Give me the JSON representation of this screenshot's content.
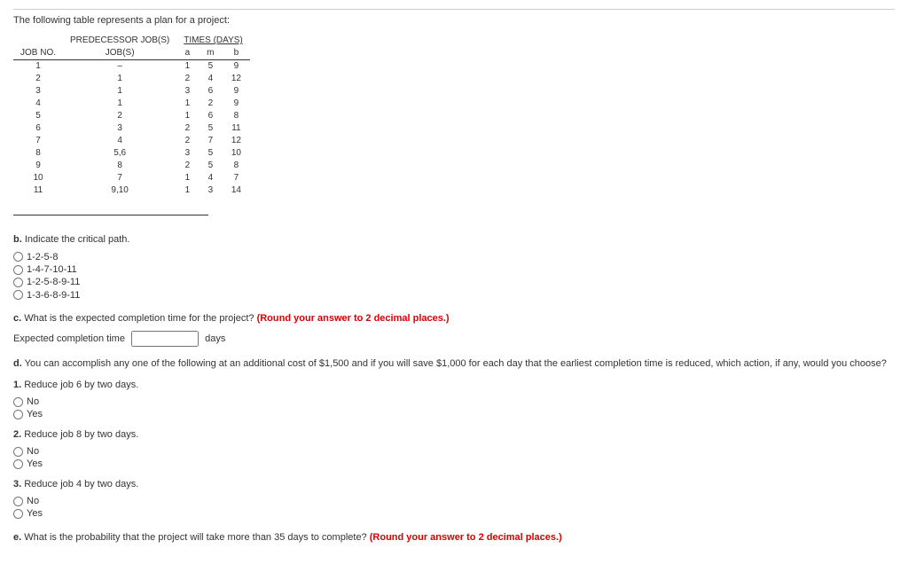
{
  "intro": "The following table represents a plan for a project:",
  "table": {
    "header": {
      "jobno": "JOB NO.",
      "pred": "PREDECESSOR JOB(S)",
      "times": "TIMES (DAYS)",
      "a": "a",
      "m": "m",
      "b": "b"
    },
    "rows": [
      {
        "job": "1",
        "pred": "–",
        "a": "1",
        "m": "5",
        "b": "9"
      },
      {
        "job": "2",
        "pred": "1",
        "a": "2",
        "m": "4",
        "b": "12"
      },
      {
        "job": "3",
        "pred": "1",
        "a": "3",
        "m": "6",
        "b": "9"
      },
      {
        "job": "4",
        "pred": "1",
        "a": "1",
        "m": "2",
        "b": "9"
      },
      {
        "job": "5",
        "pred": "2",
        "a": "1",
        "m": "6",
        "b": "8"
      },
      {
        "job": "6",
        "pred": "3",
        "a": "2",
        "m": "5",
        "b": "11"
      },
      {
        "job": "7",
        "pred": "4",
        "a": "2",
        "m": "7",
        "b": "12"
      },
      {
        "job": "8",
        "pred": "5,6",
        "a": "3",
        "m": "5",
        "b": "10"
      },
      {
        "job": "9",
        "pred": "8",
        "a": "2",
        "m": "5",
        "b": "8"
      },
      {
        "job": "10",
        "pred": "7",
        "a": "1",
        "m": "4",
        "b": "7"
      },
      {
        "job": "11",
        "pred": "9,10",
        "a": "1",
        "m": "3",
        "b": "14"
      }
    ]
  },
  "b": {
    "label": "b.",
    "text": "Indicate the critical path.",
    "opts": [
      "1-2-5-8",
      "1-4-7-10-11",
      "1-2-5-8-9-11",
      "1-3-6-8-9-11"
    ]
  },
  "c": {
    "label": "c.",
    "text": "What is the expected completion time for the project?",
    "hint": "(Round your answer to 2 decimal places.)",
    "field_label": "Expected completion time",
    "unit": "days"
  },
  "d": {
    "label": "d.",
    "text": "You can accomplish any one of the following at an additional cost of $1,500 and if you will save $1,000 for each day that the earliest completion time is reduced, which action, if any, would you choose?",
    "parts": [
      {
        "num": "1.",
        "text": "Reduce job 6 by two days.",
        "opts": [
          "No",
          "Yes"
        ]
      },
      {
        "num": "2.",
        "text": "Reduce job 8 by two days.",
        "opts": [
          "No",
          "Yes"
        ]
      },
      {
        "num": "3.",
        "text": "Reduce job 4 by two days.",
        "opts": [
          "No",
          "Yes"
        ]
      }
    ]
  },
  "e": {
    "label": "e.",
    "text": "What is the probability that the project will take more than 35 days to complete?",
    "hint": "(Round your answer to 2 decimal places.)"
  }
}
